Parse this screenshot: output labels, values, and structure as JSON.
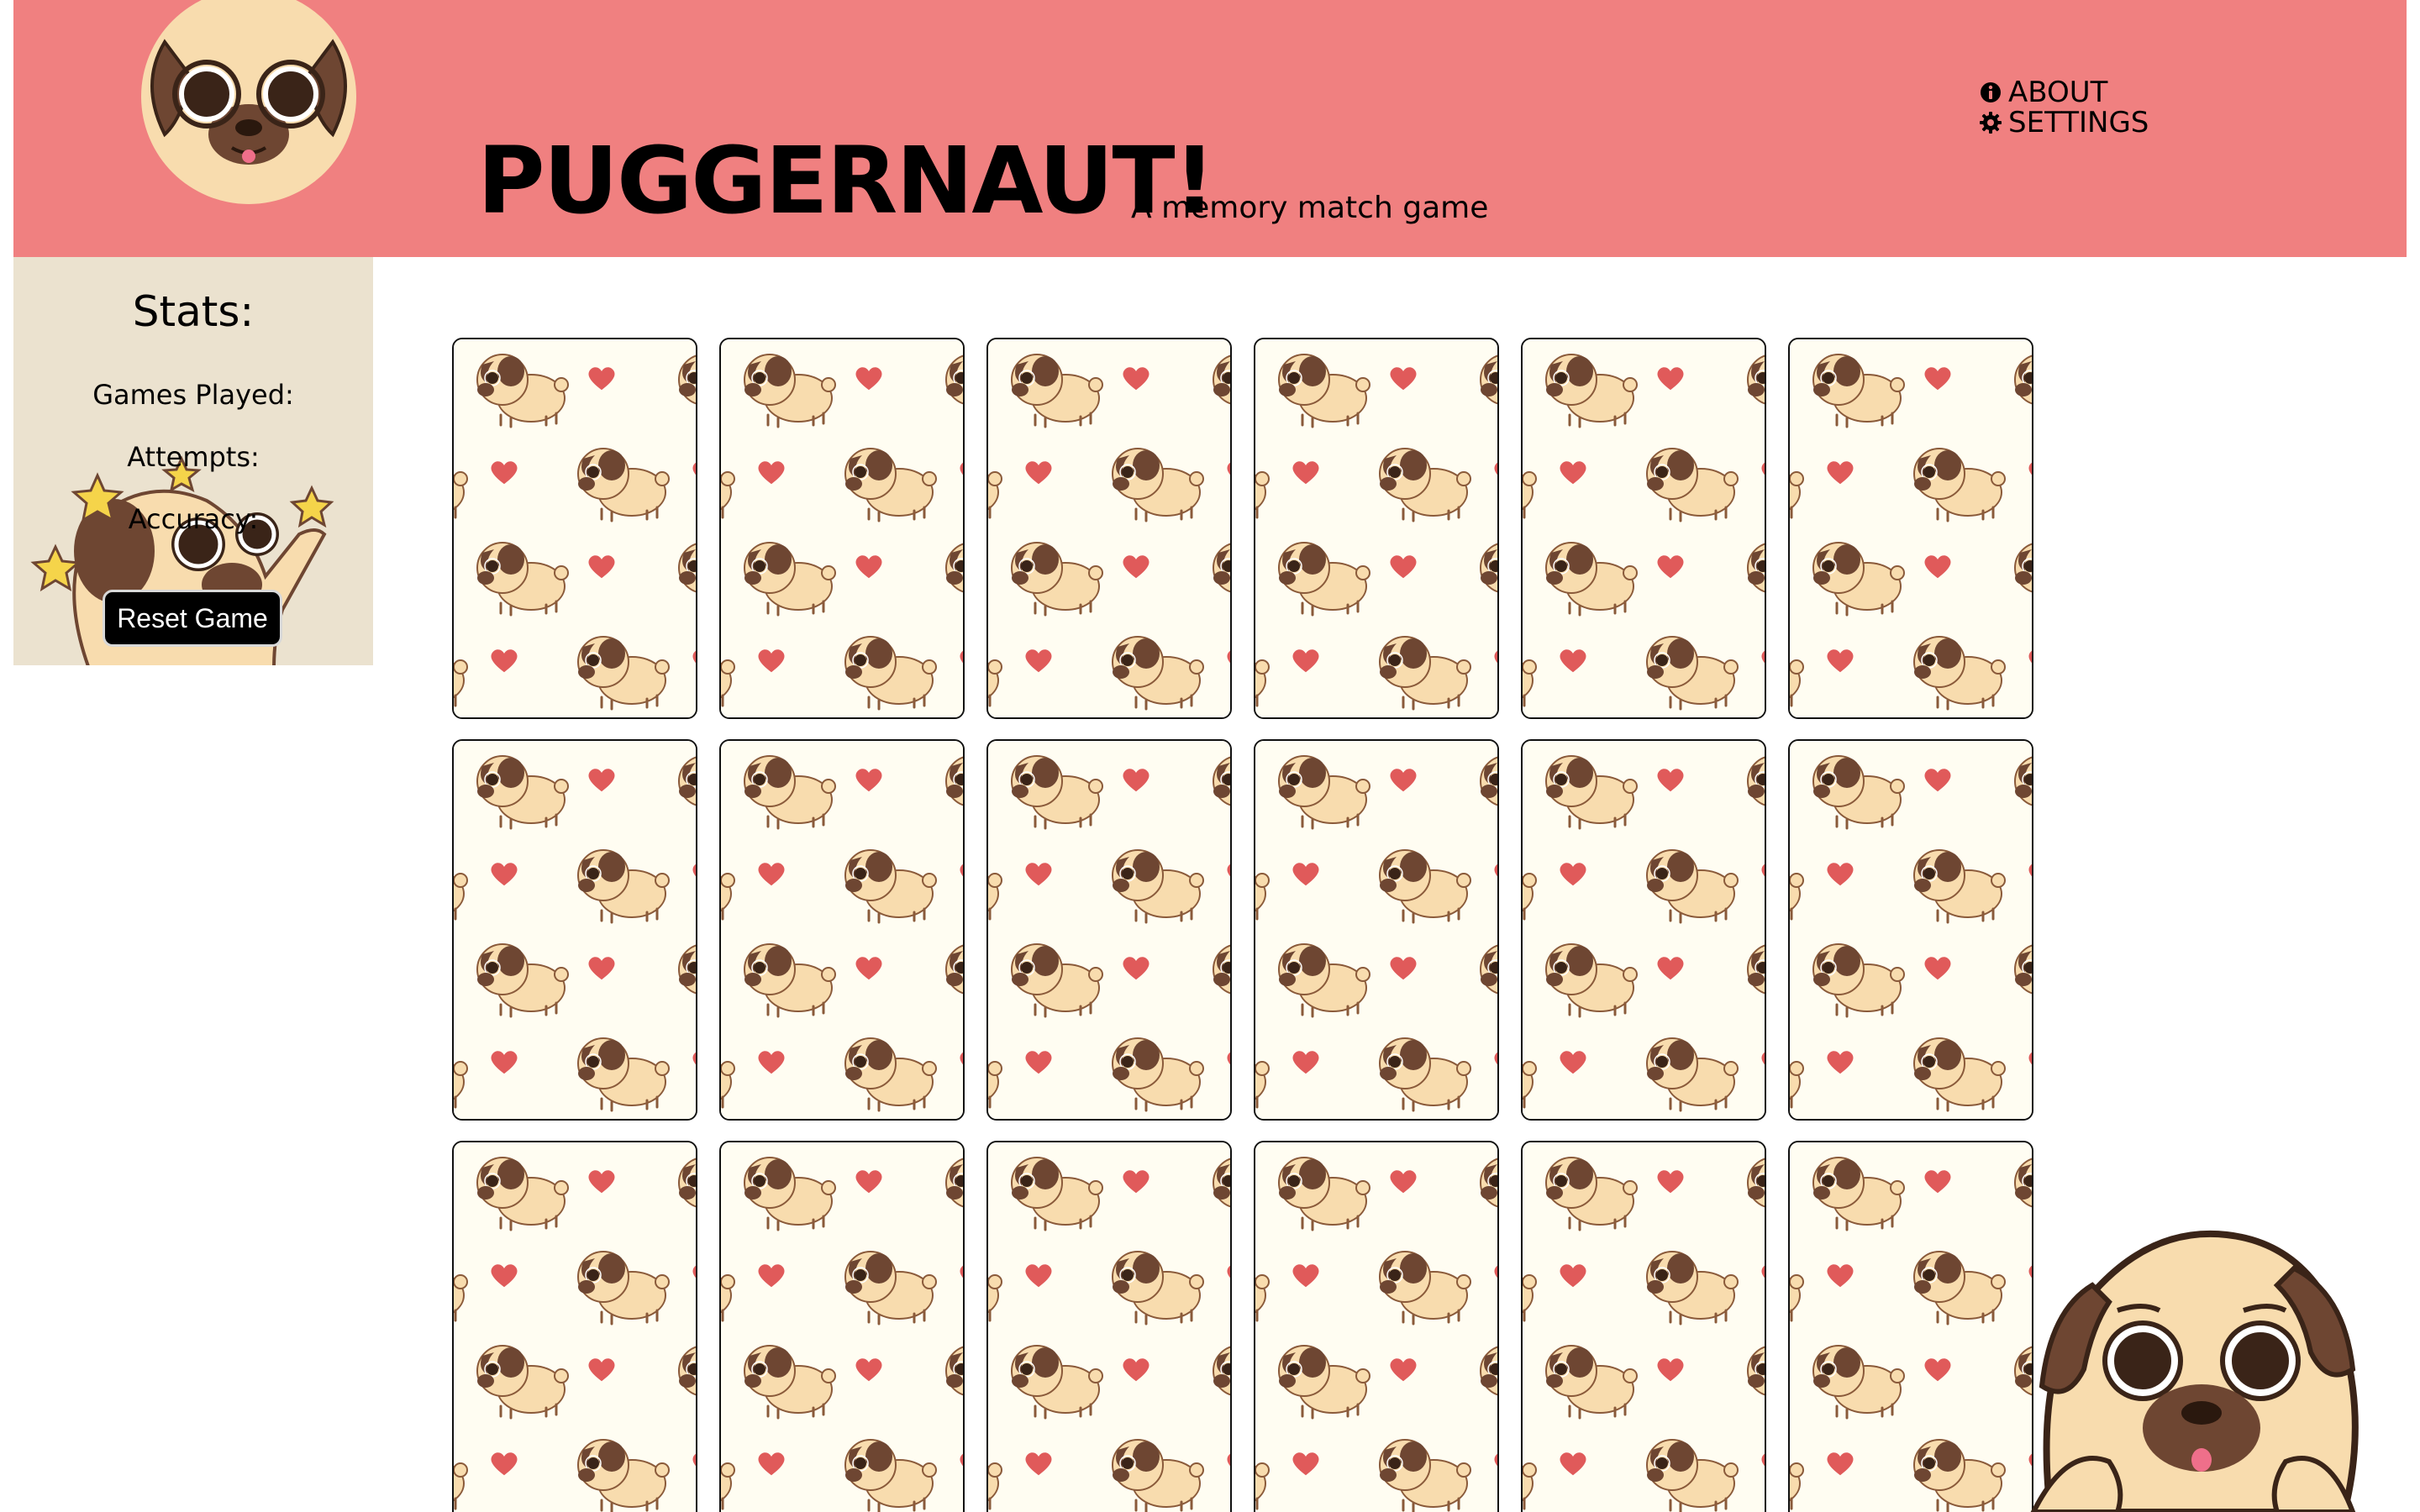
{
  "header": {
    "title": "PUGGERNAUT!",
    "subtitle": "A memory match game",
    "background_color": "#f08080",
    "logo_icon": "pug-face-icon"
  },
  "nav": {
    "items": [
      {
        "label": "ABOUT",
        "icon": "info-circle-icon"
      },
      {
        "label": "SETTINGS",
        "icon": "gear-icon"
      }
    ]
  },
  "stats": {
    "title": "Stats:",
    "games_played_label": "Games Played:",
    "attempts_label": "Attempts:",
    "accuracy_label": "Accuracy:",
    "reset_label": "Reset Game",
    "background_color": "#ebe2cf"
  },
  "board": {
    "rows": 3,
    "columns": 6,
    "card_back_pattern": "pugs-and-hearts",
    "card_back_color": "#fffdf2",
    "heart_color": "#e05a5a",
    "pug_color": "#f5d4a3"
  }
}
